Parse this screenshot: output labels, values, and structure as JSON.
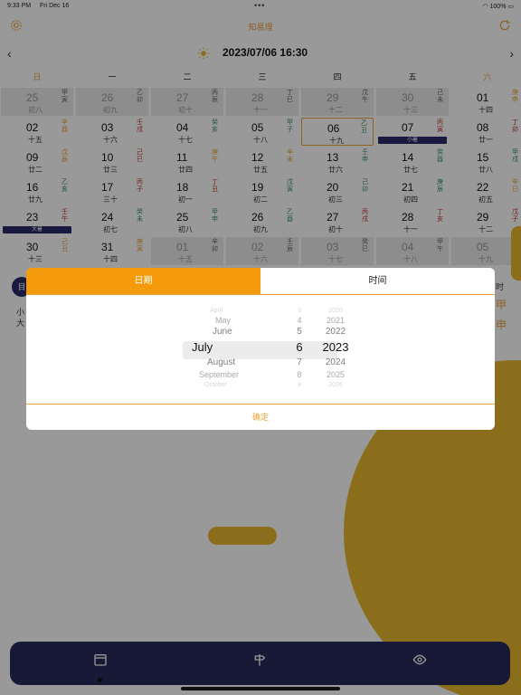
{
  "status": {
    "time": "9:33 PM",
    "date": "Fri Dec 16",
    "dots": "•••",
    "battery": "100%"
  },
  "appbar": {
    "title": "知易理",
    "left_icon": "gear-icon",
    "right_icon": "refresh-icon"
  },
  "nav": {
    "prev": "‹",
    "next": "›",
    "datetime": "2023/07/06 16:30",
    "sun_icon": "sun-icon"
  },
  "week_headers": [
    {
      "label": "日",
      "color": "#e8a33a"
    },
    {
      "label": "一",
      "color": "#222222"
    },
    {
      "label": "二",
      "color": "#222222"
    },
    {
      "label": "三",
      "color": "#222222"
    },
    {
      "label": "四",
      "color": "#222222"
    },
    {
      "label": "五",
      "color": "#222222"
    },
    {
      "label": "六",
      "color": "#e8a33a"
    }
  ],
  "calendar": [
    [
      {
        "day": "25",
        "lunar": "初八",
        "gz": "甲寅",
        "gzc": "#666666",
        "dim": true
      },
      {
        "day": "26",
        "lunar": "初九",
        "gz": "乙卯",
        "gzc": "#666666",
        "dim": true
      },
      {
        "day": "27",
        "lunar": "初十",
        "gz": "丙辰",
        "gzc": "#666666",
        "dim": true
      },
      {
        "day": "28",
        "lunar": "十一",
        "gz": "丁巳",
        "gzc": "#666666",
        "dim": true
      },
      {
        "day": "29",
        "lunar": "十二",
        "gz": "戊午",
        "gzc": "#666666",
        "dim": true
      },
      {
        "day": "30",
        "lunar": "十三",
        "gz": "己未",
        "gzc": "#666666",
        "dim": true
      },
      {
        "day": "01",
        "lunar": "十四",
        "gz": "庚申",
        "gzc": "#e8a33a",
        "dim": false
      }
    ],
    [
      {
        "day": "02",
        "lunar": "十五",
        "gz": "辛酉",
        "gzc": "#e8a33a",
        "dim": false
      },
      {
        "day": "03",
        "lunar": "十六",
        "gz": "壬戌",
        "gzc": "#c0392b",
        "dim": false
      },
      {
        "day": "04",
        "lunar": "十七",
        "gz": "癸亥",
        "gzc": "#3a8f6e",
        "dim": false
      },
      {
        "day": "05",
        "lunar": "十八",
        "gz": "甲子",
        "gzc": "#3a8f6e",
        "dim": false
      },
      {
        "day": "06",
        "lunar": "十九",
        "gz": "乙丑",
        "gzc": "#3a8f6e",
        "dim": false,
        "selected": true
      },
      {
        "day": "07",
        "lunar": "",
        "gz": "丙寅",
        "gzc": "#c0392b",
        "dim": false,
        "term": "小暑"
      },
      {
        "day": "08",
        "lunar": "廿一",
        "gz": "丁卯",
        "gzc": "#c0392b",
        "dim": false
      }
    ],
    [
      {
        "day": "09",
        "lunar": "廿二",
        "gz": "戊辰",
        "gzc": "#e8a33a",
        "dim": false
      },
      {
        "day": "10",
        "lunar": "廿三",
        "gz": "己巳",
        "gzc": "#c0392b",
        "dim": false
      },
      {
        "day": "11",
        "lunar": "廿四",
        "gz": "庚午",
        "gzc": "#e8a33a",
        "dim": false
      },
      {
        "day": "12",
        "lunar": "廿五",
        "gz": "辛未",
        "gzc": "#e8a33a",
        "dim": false
      },
      {
        "day": "13",
        "lunar": "廿六",
        "gz": "壬申",
        "gzc": "#3a8f6e",
        "dim": false
      },
      {
        "day": "14",
        "lunar": "廿七",
        "gz": "癸酉",
        "gzc": "#3a8f6e",
        "dim": false
      },
      {
        "day": "15",
        "lunar": "廿八",
        "gz": "甲戌",
        "gzc": "#3a8f6e",
        "dim": false
      }
    ],
    [
      {
        "day": "16",
        "lunar": "廿九",
        "gz": "乙亥",
        "gzc": "#3a8f6e",
        "dim": false
      },
      {
        "day": "17",
        "lunar": "三十",
        "gz": "丙子",
        "gzc": "#c0392b",
        "dim": false
      },
      {
        "day": "18",
        "lunar": "初一",
        "gz": "丁丑",
        "gzc": "#c0392b",
        "dim": false
      },
      {
        "day": "19",
        "lunar": "初二",
        "gz": "戊寅",
        "gzc": "#3a8f6e",
        "dim": false
      },
      {
        "day": "20",
        "lunar": "初三",
        "gz": "己卯",
        "gzc": "#3a8f6e",
        "dim": false
      },
      {
        "day": "21",
        "lunar": "初四",
        "gz": "庚辰",
        "gzc": "#3a8f6e",
        "dim": false
      },
      {
        "day": "22",
        "lunar": "初五",
        "gz": "辛巳",
        "gzc": "#e8a33a",
        "dim": false
      }
    ],
    [
      {
        "day": "23",
        "lunar": "",
        "gz": "壬午",
        "gzc": "#c0392b",
        "dim": false,
        "term": "大暑"
      },
      {
        "day": "24",
        "lunar": "初七",
        "gz": "癸未",
        "gzc": "#3a8f6e",
        "dim": false
      },
      {
        "day": "25",
        "lunar": "初八",
        "gz": "甲申",
        "gzc": "#3a8f6e",
        "dim": false
      },
      {
        "day": "26",
        "lunar": "初九",
        "gz": "乙酉",
        "gzc": "#3a8f6e",
        "dim": false
      },
      {
        "day": "27",
        "lunar": "初十",
        "gz": "丙戌",
        "gzc": "#c0392b",
        "dim": false
      },
      {
        "day": "28",
        "lunar": "十一",
        "gz": "丁亥",
        "gzc": "#c0392b",
        "dim": false
      },
      {
        "day": "29",
        "lunar": "十二",
        "gz": "戊子",
        "gzc": "#c0392b",
        "dim": false
      }
    ],
    [
      {
        "day": "30",
        "lunar": "十三",
        "gz": "己丑",
        "gzc": "#e8a33a",
        "dim": false
      },
      {
        "day": "31",
        "lunar": "十四",
        "gz": "庚寅",
        "gzc": "#e8a33a",
        "dim": false
      },
      {
        "day": "01",
        "lunar": "十五",
        "gz": "辛卯",
        "gzc": "#666666",
        "dim": true
      },
      {
        "day": "02",
        "lunar": "十六",
        "gz": "壬辰",
        "gzc": "#666666",
        "dim": true
      },
      {
        "day": "03",
        "lunar": "十七",
        "gz": "癸巳",
        "gzc": "#666666",
        "dim": true
      },
      {
        "day": "04",
        "lunar": "十八",
        "gz": "甲午",
        "gzc": "#666666",
        "dim": true
      },
      {
        "day": "05",
        "lunar": "十九",
        "gz": "乙未",
        "gzc": "#666666",
        "dim": true
      }
    ]
  ],
  "behind": {
    "left_badge": "目",
    "left_line1": "小",
    "left_line2": "大",
    "right_line1": "时",
    "right_line2": "甲",
    "right_line3": "申"
  },
  "picker": {
    "tabs": [
      "日期",
      "时间"
    ],
    "months": [
      "April",
      "May",
      "June",
      "July",
      "August",
      "September",
      "October"
    ],
    "days": [
      "3",
      "4",
      "5",
      "6",
      "7",
      "8",
      "9"
    ],
    "years": [
      "2020",
      "2021",
      "2022",
      "2023",
      "2024",
      "2025",
      "2026"
    ],
    "confirm": "确定"
  },
  "bottom_nav": {
    "icons": [
      "calendar-icon",
      "signpost-icon",
      "eye-icon"
    ]
  },
  "colors": {
    "accent": "#f59a0a",
    "navy": "#29285c",
    "gold": "#e8b830"
  }
}
